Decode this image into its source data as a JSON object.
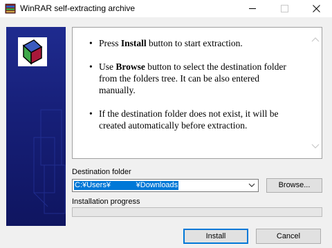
{
  "window": {
    "title": "WinRAR self-extracting archive"
  },
  "info": {
    "items": [
      {
        "pre": "Press ",
        "bold": "Install",
        "post": " button to start extraction."
      },
      {
        "pre": "Use ",
        "bold": "Browse",
        "post": " button to select the destination folder from the folders tree. It can be also entered manually."
      },
      {
        "pre": "If the destination folder does not exist, it will be created automatically before extraction.",
        "bold": "",
        "post": ""
      }
    ]
  },
  "destination": {
    "label": "Destination folder",
    "value": "C:¥Users¥            ¥Downloads",
    "browse_label": "Browse..."
  },
  "progress": {
    "label": "Installation progress",
    "fraction": 0
  },
  "buttons": {
    "install_label": "Install",
    "cancel_label": "Cancel"
  }
}
